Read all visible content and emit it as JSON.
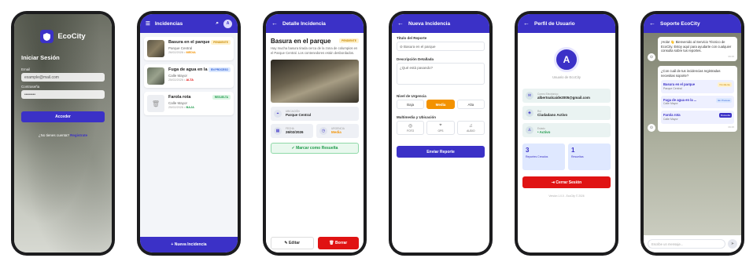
{
  "login": {
    "app_name": "EcoCity",
    "title": "Iniciar Sesión",
    "email_label": "Email",
    "email_placeholder": "example@mail.com",
    "password_label": "Contraseña",
    "password_placeholder": "••••••••",
    "submit": "Acceder",
    "no_account": "¿No tienes cuenta?",
    "register": "Registrate"
  },
  "list": {
    "title": "Incidencias",
    "items": [
      {
        "title": "Basura en el parque",
        "location": "Parque Central",
        "date": "26/02/2026",
        "priority": "MEDIA",
        "status": "PENDIENTE"
      },
      {
        "title": "Fuga de agua en la c...",
        "location": "Calle Mayor",
        "date": "25/02/2026",
        "priority": "ALTA",
        "status": "EN PROCESO"
      },
      {
        "title": "Farola rota",
        "location": "Calle Mayor",
        "date": "25/02/2026",
        "priority": "BAJA",
        "status": "RESUELTA"
      }
    ],
    "new_button": "+ Nueva Incidencia"
  },
  "detail": {
    "header": "Detalle Incidencia",
    "title": "Basura en el parque",
    "status": "PENDIENTE",
    "description": "Hay mucha basura tirada cerca de la zona de columpios en el Parque Central. Los contenedores están desbordados.",
    "location_label": "UBICACIÓN",
    "location": "Parque Central",
    "date_label": "FECHA",
    "date": "26/02/2026",
    "priority_label": "URGENCIA",
    "priority": "Media",
    "resolve_button": "Marcar como Resuelta",
    "edit_button": "Editar",
    "delete_button": "Borrar"
  },
  "new_report": {
    "header": "Nueva Incidencia",
    "title_label": "Título del Reporte",
    "title_value": "Basura en el parque",
    "desc_label": "Descripción Detallada",
    "desc_placeholder": "¿Qué está pasando?",
    "urgency_label": "Nivel de Urgencia",
    "urgency_options": [
      "Baja",
      "Media",
      "Alta"
    ],
    "media_label": "Multimedia y Ubicación",
    "media_options": [
      "FOTO",
      "GPS",
      "AUDIO"
    ],
    "submit": "Enviar Reporte"
  },
  "profile": {
    "header": "Perfil de Usuario",
    "initial": "A",
    "subtitle": "Usuario de EcoCity",
    "email_label": "Correo Electrónico",
    "email": "albertoalcaide2005@gmail.com",
    "role_label": "Rol",
    "role": "Ciudadano Activo",
    "state_label": "Estado",
    "state": "• Activo",
    "stats": [
      {
        "n": "3",
        "l": "Reportes Creados"
      },
      {
        "n": "1",
        "l": "Resueltas"
      }
    ],
    "logout": "Cerrar Sesión",
    "version": "Versión 1.0.0 - EcoCity © 2026"
  },
  "chat": {
    "header": "Soporte EcoCity",
    "welcome": "¡Hola! 👋 Bienvenido al Servicio Técnico de EcoCity. Estoy aquí para ayudarte con cualquier consulta sobre tus reportes.",
    "time1": "09:15",
    "question": "¿Con cuál de tus incidencias registradas necesitas soporte?",
    "options": [
      {
        "t": "Basura en el parque",
        "s": "Parque Central",
        "b": "Pendiente"
      },
      {
        "t": "Fuga de agua en la ...",
        "s": "Calle Mayor",
        "b": "En Proceso"
      },
      {
        "t": "Farola rota",
        "s": "Calle Mayor",
        "b": "Resuelta"
      }
    ],
    "time2": "09:15",
    "input_placeholder": "Escribe un mensaje..."
  }
}
